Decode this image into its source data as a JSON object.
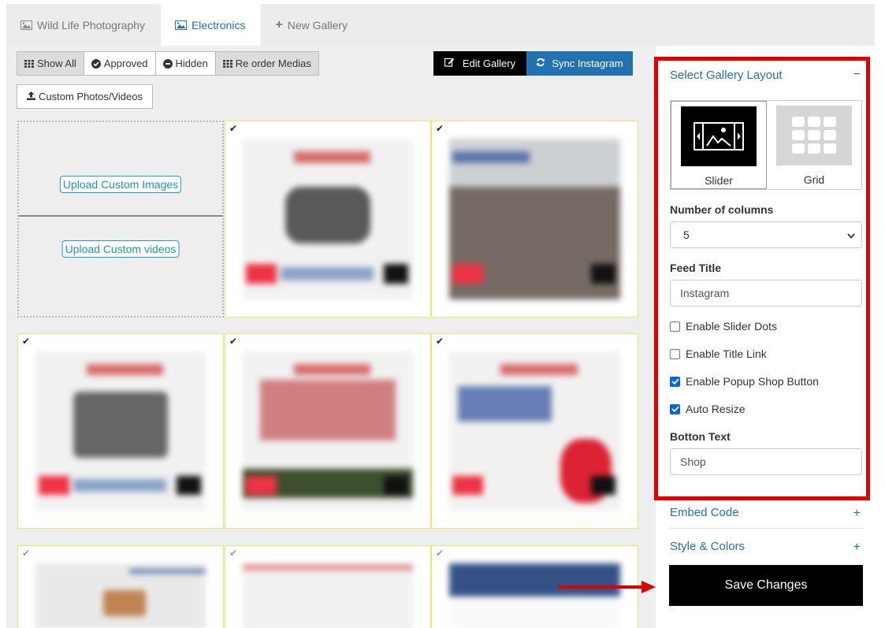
{
  "tabs": [
    {
      "label": "Wild Life Photography",
      "icon": "image-icon"
    },
    {
      "label": "Electronics",
      "icon": "image-icon",
      "active": true
    },
    {
      "label": "New Gallery",
      "icon": "plus-icon"
    }
  ],
  "toolbar": {
    "show_all": "Show All",
    "approved": "Approved",
    "hidden": "Hidden",
    "reorder": "Re order Medias",
    "edit_gallery": "Edit Gallery",
    "sync_instagram": "Sync Instagram",
    "custom_media": "Custom Photos/Videos"
  },
  "upload": {
    "images": "Upload Custom Images",
    "videos": "Upload Custom videos"
  },
  "sidebar": {
    "layout": {
      "title": "Select Gallery Layout",
      "toggle": "−",
      "options": [
        {
          "label": "Slider",
          "selected": true
        },
        {
          "label": "Grid",
          "selected": false
        }
      ]
    },
    "columns": {
      "label": "Number of columns",
      "value": "5"
    },
    "feed_title": {
      "label": "Feed Title",
      "value": "Instagram"
    },
    "checkboxes": [
      {
        "label": "Enable Slider Dots",
        "checked": false
      },
      {
        "label": "Enable Title Link",
        "checked": false
      },
      {
        "label": "Enable Popup Shop Button",
        "checked": true
      },
      {
        "label": "Auto Resize",
        "checked": true
      }
    ],
    "button_text": {
      "label": "Botton Text",
      "value": "Shop"
    },
    "embed": {
      "title": "Embed Code",
      "toggle": "+"
    },
    "style": {
      "title": "Style & Colors",
      "toggle": "+"
    },
    "save": "Save Changes"
  },
  "colors": {
    "accent": "#2271b1",
    "highlight": "#e00000",
    "tile_border": "#f4e26a"
  }
}
